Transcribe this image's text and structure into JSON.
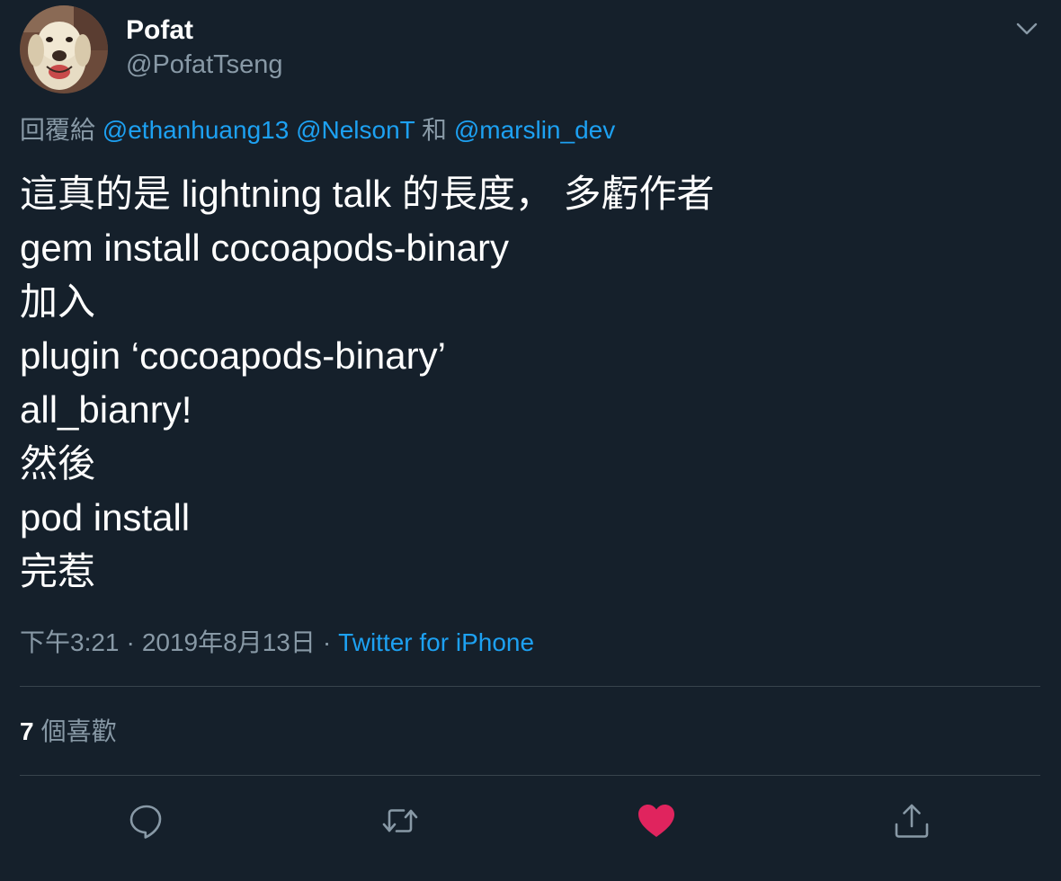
{
  "user": {
    "display_name": "Pofat",
    "handle": "@PofatTseng"
  },
  "reply": {
    "prefix": "回覆給",
    "mention_1": "@ethanhuang13",
    "mention_2": "@NelsonT",
    "conjunction": "和",
    "mention_3": "@marslin_dev"
  },
  "tweet": {
    "lines": [
      "這真的是 lightning talk 的長度， 多虧作者",
      "gem install cocoapods-binary",
      "加入",
      "plugin ‘cocoapods-binary’",
      "all_bianry!",
      "然後",
      "pod install",
      "完惹"
    ]
  },
  "meta": {
    "time": "下午3:21",
    "separator": "·",
    "date": "2019年8月13日",
    "source": "Twitter for iPhone"
  },
  "stats": {
    "likes_count": "7",
    "likes_label": "個喜歡"
  },
  "icons": {
    "reply": "reply-icon",
    "retweet": "retweet-icon",
    "like": "heart-icon",
    "share": "share-icon",
    "menu": "chevron-down-icon"
  },
  "colors": {
    "background": "#15202b",
    "text": "#ffffff",
    "secondary_text": "#8899a6",
    "link": "#1da1f2",
    "liked": "#e0245e",
    "divider": "#38444d"
  }
}
